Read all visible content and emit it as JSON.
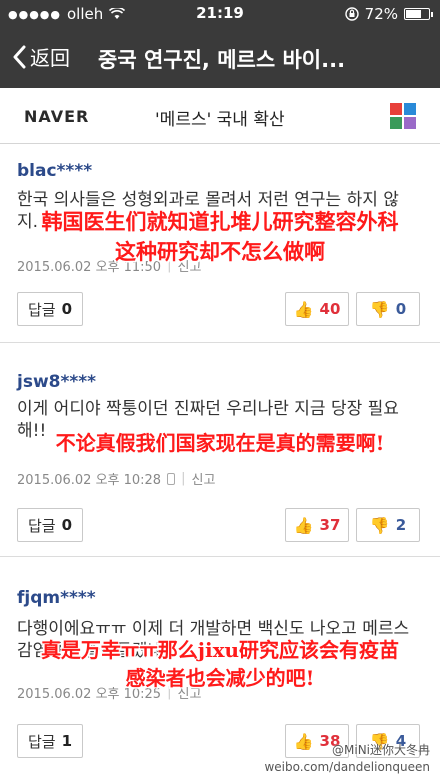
{
  "status": {
    "carrier": "olleh",
    "time": "21:19",
    "battery": "72%",
    "battery_level": 0.72
  },
  "nav": {
    "back_label": "返回",
    "title": "중국 연구진, 메르스 바이..."
  },
  "header": {
    "logo": "NAVER",
    "title": "'메르스' 국내 확산",
    "grid_colors": [
      "#e8403a",
      "#2a8ad8",
      "#3a9a5a",
      "#9a6ac8"
    ]
  },
  "comments": [
    {
      "user": "blac****",
      "text": "한국 의사들은 성형외과로 몰려서 저런 연구는 하지 않지.",
      "date": "2015.06.02 오후 11:50",
      "report": "신고",
      "reply_label": "답글",
      "reply_count": "0",
      "likes": "40",
      "dislikes": "0",
      "overlay": [
        "韩国医生们就知道扎堆儿研究整容外科",
        "这种研究却不怎么做啊"
      ]
    },
    {
      "user": "jsw8****",
      "text": "이게 어디야 짝퉁이던 진짜던 우리나란 지금 당장 필요해!!",
      "date": "2015.06.02 오후 10:28",
      "report": "신고",
      "reply_label": "답글",
      "reply_count": "0",
      "likes": "37",
      "dislikes": "2",
      "overlay": [
        "不论真假我们国家现在是真的需要啊!"
      ]
    },
    {
      "user": "fjqm****",
      "text": "다행이에요ㅠㅠ 이제 더 개발하면 백신도 나오고 메르스 감염자도 줄어들겠네요.",
      "date": "2015.06.02 오후 10:25",
      "report": "신고",
      "reply_label": "답글",
      "reply_count": "1",
      "likes": "38",
      "dislikes": "4",
      "overlay": [
        "真是万幸ㅠㅠ那么jixu研究应该会有疫苗",
        "感染者也会减少的吧!"
      ]
    }
  ],
  "watermark": {
    "line1": "@MiNi迷你大冬冉",
    "line2": "weibo.com/dandelionqueen"
  }
}
